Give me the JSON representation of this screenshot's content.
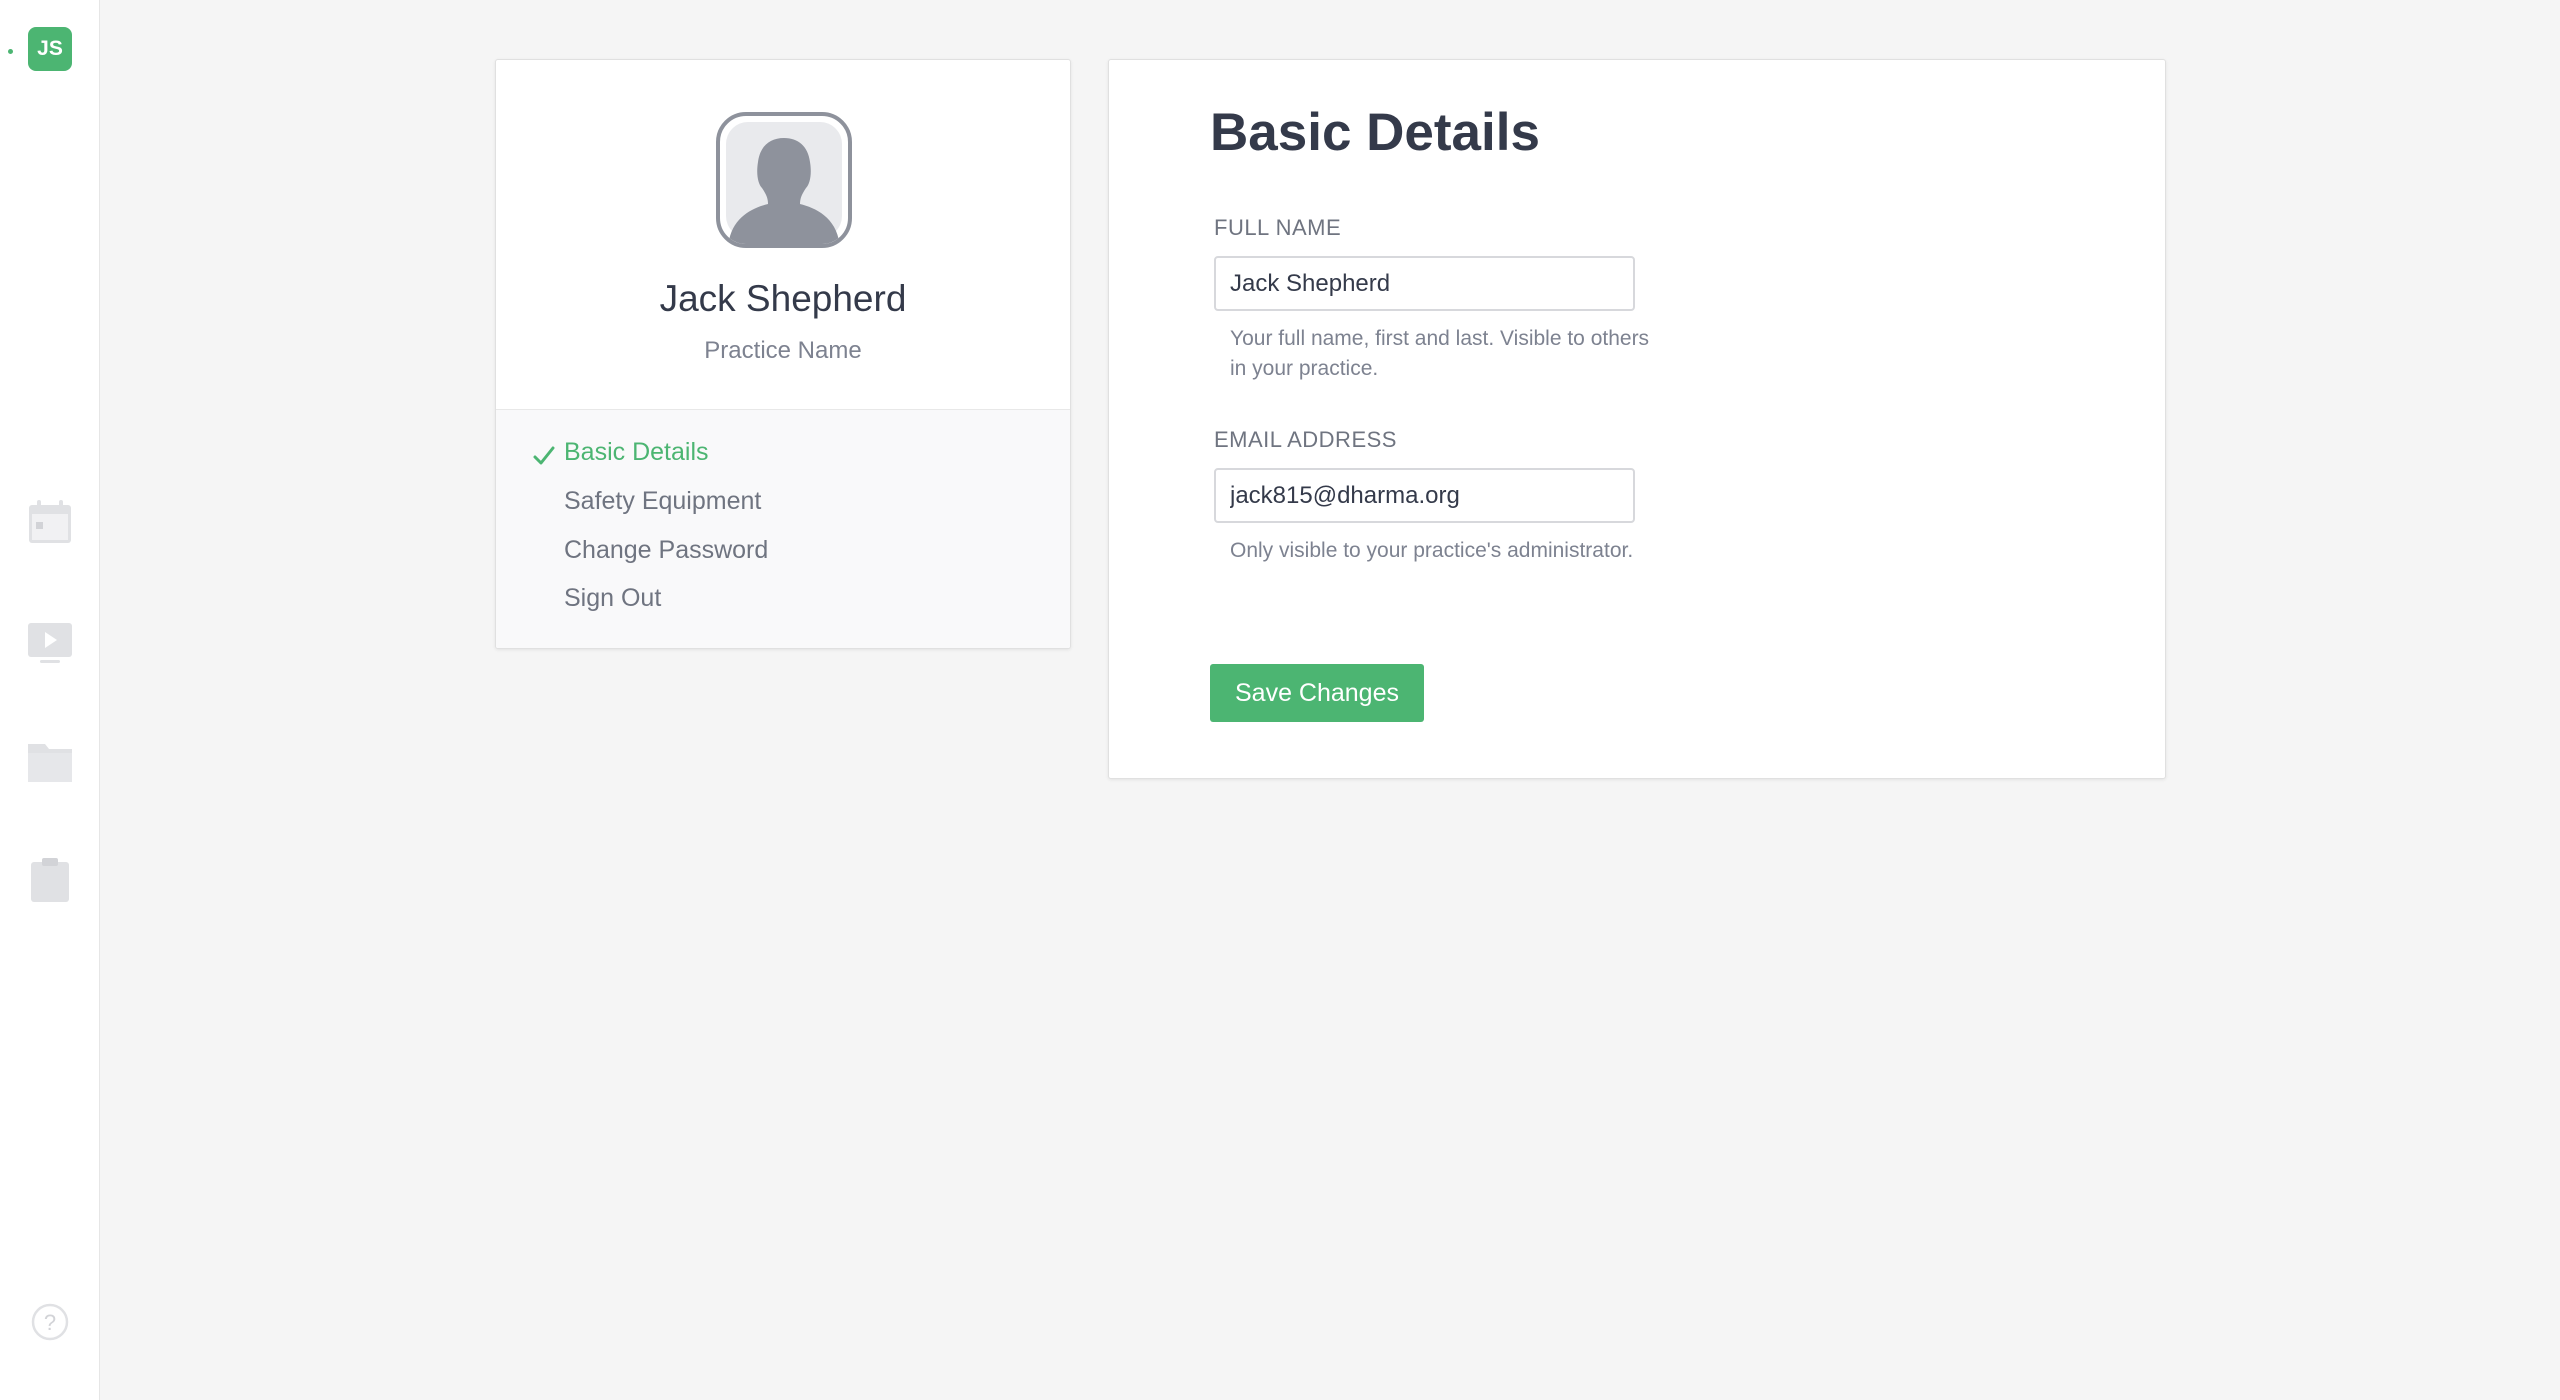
{
  "sidebar": {
    "avatar_initials": "JS",
    "icons": [
      "calendar-icon",
      "video-icon",
      "folder-icon",
      "clipboard-icon",
      "help-icon"
    ],
    "accent_color": "#4cb572",
    "icon_color": "#e0e1e4"
  },
  "profile": {
    "name": "Jack Shepherd",
    "practice": "Practice Name",
    "nav": [
      {
        "label": "Basic Details",
        "active": true
      },
      {
        "label": "Safety Equipment",
        "active": false
      },
      {
        "label": "Change Password",
        "active": false
      },
      {
        "label": "Sign Out",
        "active": false
      }
    ]
  },
  "form": {
    "title": "Basic Details",
    "full_name": {
      "label": "FULL NAME",
      "value": "Jack Shepherd",
      "help": "Your full name, first and last. Visible to others in your practice."
    },
    "email": {
      "label": "EMAIL ADDRESS",
      "value": "jack815@dharma.org",
      "help": "Only visible to your practice's administrator."
    },
    "save_label": "Save Changes"
  }
}
